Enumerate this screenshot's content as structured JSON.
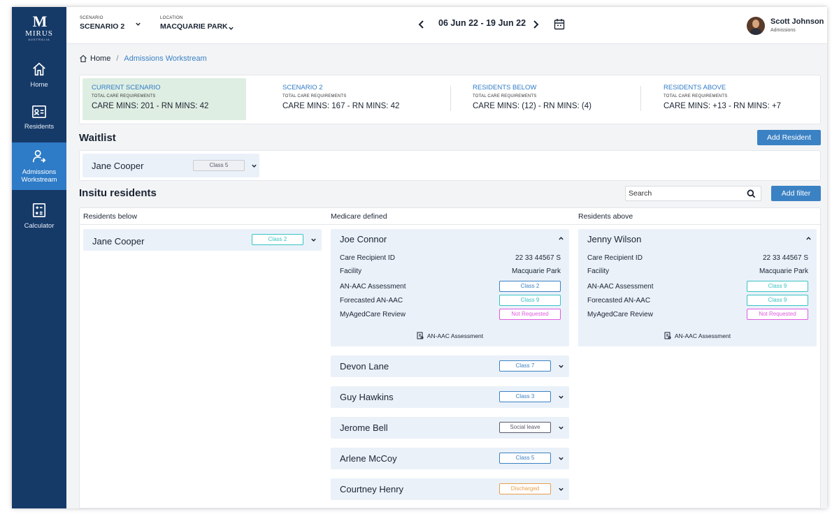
{
  "sidebar": {
    "logo": {
      "mark": "M",
      "name": "MIRUS",
      "sub": "AUSTRALIA"
    },
    "items": [
      {
        "label": "Home",
        "icon": "home-icon"
      },
      {
        "label": "Residents",
        "icon": "id-card-icon"
      },
      {
        "label": "Admissions Workstream",
        "icon": "user-check-icon",
        "active": true
      },
      {
        "label": "Calculator",
        "icon": "calculator-icon"
      }
    ]
  },
  "topbar": {
    "scenario": {
      "label": "SCENARIO",
      "value": "SCENARIO 2"
    },
    "location": {
      "label": "LOCATION",
      "value": "MACQUARIE PARK"
    },
    "date_range": "06 Jun 22 - 19 Jun 22",
    "user": {
      "name": "Scott Johnson",
      "role": "Admissions"
    }
  },
  "breadcrumb": {
    "home": "Home",
    "separator": "/",
    "current": "Admissions Workstream"
  },
  "summary": [
    {
      "title": "CURRENT SCENARIO",
      "subtitle": "TOTAL CARE REQUIREMENTS",
      "value": "CARE MINS: 201 - RN MINS: 42"
    },
    {
      "title": "SCENARIO 2",
      "subtitle": "TOTAL CARE REQUIREMENTS",
      "value": "CARE MINS: 167 - RN MINS: 42"
    },
    {
      "title": "RESIDENTS BELOW",
      "subtitle": "TOTAL CARE REQUIREMENTS",
      "value": "CARE MINS: (12) - RN MINS: (4)"
    },
    {
      "title": "RESIDENTS ABOVE",
      "subtitle": "TOTAL CARE REQUIREMENTS",
      "value": "CARE MINS: +13 - RN MINS: +7"
    }
  ],
  "waitlist": {
    "title": "Waitlist",
    "add_button": "Add Resident",
    "items": [
      {
        "name": "Jane Cooper",
        "class": "Class 5"
      }
    ]
  },
  "insitu": {
    "title": "Insitu residents",
    "search_placeholder": "Search",
    "filter_button": "Add filter",
    "columns": {
      "below": {
        "title": "Residents below",
        "items": [
          {
            "name": "Jane Cooper",
            "class": "Class 2"
          }
        ]
      },
      "medicare": {
        "title": "Medicare defined",
        "expanded": {
          "name": "Joe Connor",
          "fields": [
            {
              "label": "Care Recipient ID",
              "value": "22 33 44567 S"
            },
            {
              "label": "Facility",
              "value": "Macquarie Park"
            },
            {
              "label": "AN-AAC Assessment",
              "badge": "Class 2"
            },
            {
              "label": "Forecasted AN-AAC",
              "badge": "Class 9"
            },
            {
              "label": "MyAgedCare Review",
              "badge": "Not Requested"
            }
          ],
          "link": "AN-AAC Assessment"
        },
        "items": [
          {
            "name": "Devon Lane",
            "class": "Class 7"
          },
          {
            "name": "Guy Hawkins",
            "class": "Class 3"
          },
          {
            "name": "Jerome Bell",
            "class": "Social leave"
          },
          {
            "name": "Arlene McCoy",
            "class": "Class 5"
          },
          {
            "name": "Courtney Henry",
            "class": "Discharged"
          }
        ]
      },
      "above": {
        "title": "Residents above",
        "expanded": {
          "name": "Jenny Wilson",
          "fields": [
            {
              "label": "Care Recipient ID",
              "value": "22 33 44567 S"
            },
            {
              "label": "Facility",
              "value": "Macquarie Park"
            },
            {
              "label": "AN-AAC Assessment",
              "badge": "Class 9"
            },
            {
              "label": "Forecasted AN-AAC",
              "badge": "Class 9"
            },
            {
              "label": "MyAgedCare Review",
              "badge": "Not Requested"
            }
          ],
          "link": "AN-AAC Assessment"
        }
      }
    }
  },
  "colors": {
    "sidebar_bg": "#163a68",
    "active_nav": "#2e7bc7",
    "accent": "#3b82c4",
    "badge_blue": "#3b82c4",
    "badge_teal": "#38c3c3",
    "badge_magenta": "#e05ae0",
    "badge_gray": "#5a5a6a",
    "badge_orange": "#e8a04a"
  }
}
